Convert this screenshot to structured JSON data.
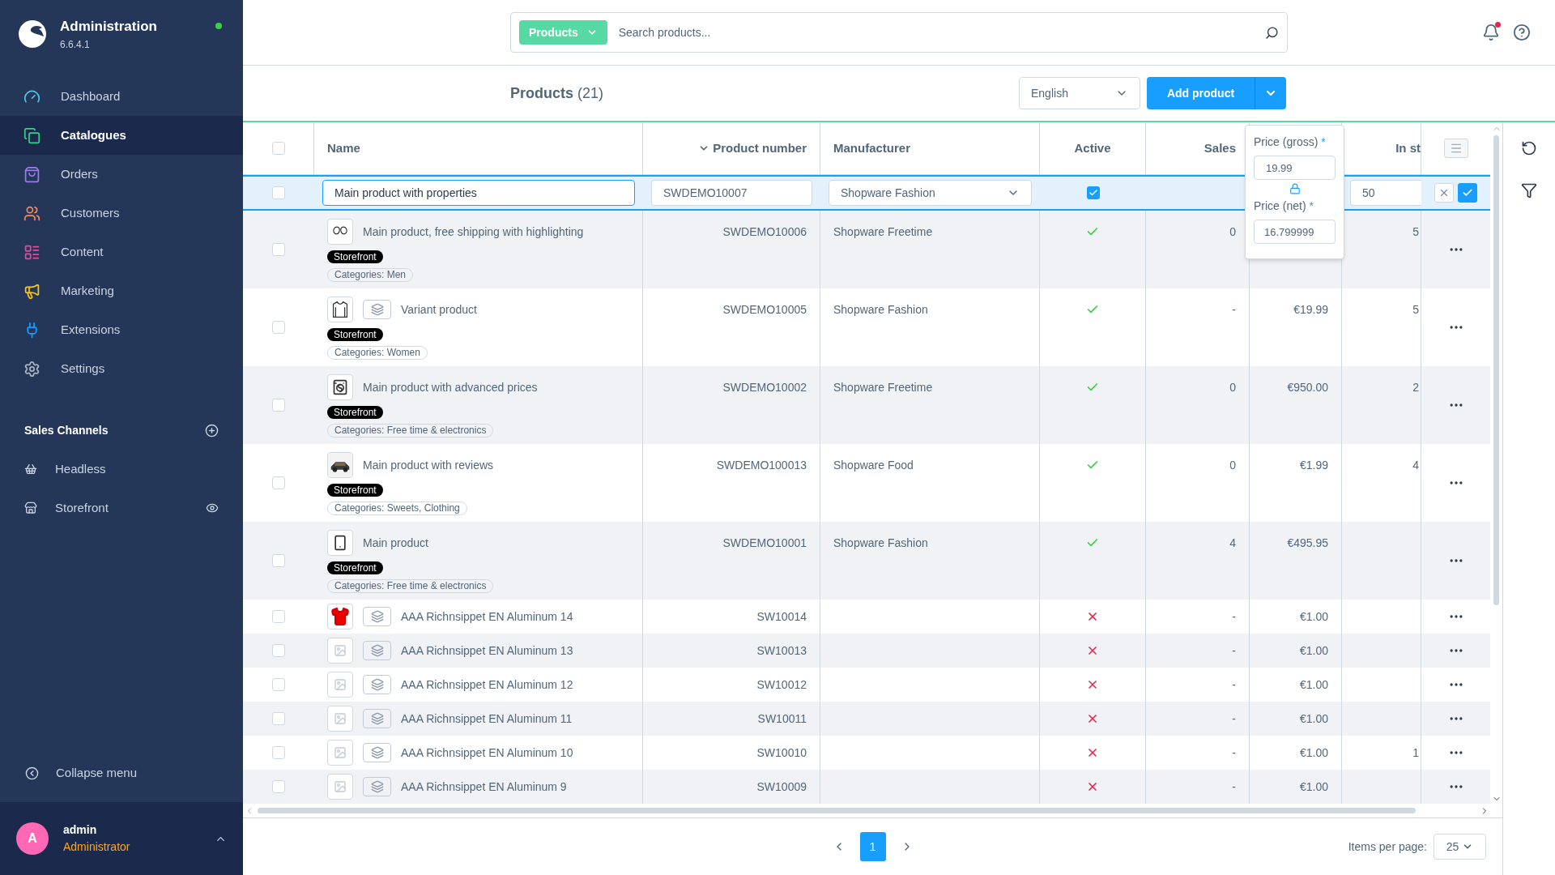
{
  "sidebar": {
    "app_name": "Administration",
    "version": "6.6.4.1",
    "nav": [
      {
        "label": "Dashboard",
        "color": "#52c1e8",
        "selected": false
      },
      {
        "label": "Catalogues",
        "color": "#3cc98c",
        "selected": true
      },
      {
        "label": "Orders",
        "color": "#9a7be8",
        "selected": false
      },
      {
        "label": "Customers",
        "color": "#f08a5d",
        "selected": false
      },
      {
        "label": "Content",
        "color": "#ec4899",
        "selected": false
      },
      {
        "label": "Marketing",
        "color": "#f5c518",
        "selected": false
      },
      {
        "label": "Extensions",
        "color": "#189eff",
        "selected": false
      },
      {
        "label": "Settings",
        "color": "#aab4c3",
        "selected": false
      }
    ],
    "sales_channels": {
      "title": "Sales Channels",
      "items": [
        {
          "label": "Headless"
        },
        {
          "label": "Storefront"
        }
      ]
    },
    "collapse": "Collapse menu",
    "user": {
      "initial": "A",
      "name": "admin",
      "role": "Administrator"
    }
  },
  "search": {
    "scope": "Products",
    "placeholder": "Search products..."
  },
  "header": {
    "title": "Products",
    "count": "(21)",
    "language": "English",
    "add_button": "Add product"
  },
  "table": {
    "all_selected": false,
    "columns": [
      {
        "label": "Name",
        "sorted": false
      },
      {
        "label": "Product number",
        "sorted": true
      },
      {
        "label": "Manufacturer",
        "sorted": false
      },
      {
        "label": "Active",
        "sorted": false
      },
      {
        "label": "Sales",
        "sorted": false
      },
      {
        "label": "In st",
        "sorted": false
      }
    ],
    "edit_row": {
      "selected": false,
      "name": "Main product with properties",
      "product_number": "SWDEMO10007",
      "manufacturer": "Shopware Fashion",
      "active": true,
      "stock": "50"
    },
    "price_popover": {
      "gross_label": "Price (gross)",
      "gross": "19.99",
      "net_label": "Price (net)",
      "net": "16.799999",
      "mark": "*"
    },
    "rows": [
      {
        "selected": false,
        "name": "Main product, free shipping with highlighting",
        "variant": false,
        "badge": "Storefront",
        "categories": "Categories: Men",
        "product_number": "SWDEMO10006",
        "manufacturer": "Shopware Freetime",
        "active": true,
        "sales": "0",
        "stock": "5"
      },
      {
        "selected": false,
        "name": "Variant product",
        "variant": true,
        "badge": "Storefront",
        "categories": "Categories: Women",
        "product_number": "SWDEMO10005",
        "manufacturer": "Shopware Fashion",
        "active": true,
        "sales": "-",
        "price": "€19.99",
        "stock": "5"
      },
      {
        "selected": false,
        "name": "Main product with advanced prices",
        "variant": false,
        "badge": "Storefront",
        "categories": "Categories: Free time & electronics",
        "product_number": "SWDEMO10002",
        "manufacturer": "Shopware Freetime",
        "active": true,
        "sales": "0",
        "price": "€950.00",
        "stock": "2"
      },
      {
        "selected": false,
        "name": "Main product with reviews",
        "variant": false,
        "badge": "Storefront",
        "categories": "Categories: Sweets, Clothing",
        "product_number": "SWDEMO100013",
        "manufacturer": "Shopware Food",
        "active": true,
        "sales": "0",
        "price": "€1.99",
        "stock": "4"
      },
      {
        "selected": false,
        "name": "Main product",
        "variant": false,
        "badge": "Storefront",
        "categories": "Categories: Free time & electronics",
        "product_number": "SWDEMO10001",
        "manufacturer": "Shopware Fashion",
        "active": true,
        "sales": "4",
        "price": "€495.95"
      },
      {
        "selected": false,
        "name": "AAA Richnsippet EN Aluminum 14",
        "variant": true,
        "product_number": "SW10014",
        "active": false,
        "sales": "-",
        "price": "€1.00"
      },
      {
        "selected": false,
        "name": "AAA Richnsippet EN Aluminum 13",
        "variant": true,
        "product_number": "SW10013",
        "active": false,
        "sales": "-",
        "price": "€1.00"
      },
      {
        "selected": false,
        "name": "AAA Richnsippet EN Aluminum 12",
        "variant": true,
        "product_number": "SW10012",
        "active": false,
        "sales": "-",
        "price": "€1.00"
      },
      {
        "selected": false,
        "name": "AAA Richnsippet EN Aluminum 11",
        "variant": true,
        "product_number": "SW10011",
        "active": false,
        "sales": "-",
        "price": "€1.00"
      },
      {
        "selected": false,
        "name": "AAA Richnsippet EN Aluminum 10",
        "variant": true,
        "product_number": "SW10010",
        "active": false,
        "sales": "-",
        "price": "€1.00",
        "stock": "1"
      },
      {
        "selected": false,
        "name": "AAA Richnsippet EN Aluminum 9",
        "variant": true,
        "product_number": "SW10009",
        "active": false,
        "sales": "-",
        "price": "€1.00"
      }
    ]
  },
  "footer": {
    "pages": [
      {
        "label": "1",
        "selected": true
      }
    ],
    "items_per_page_label": "Items per page:",
    "items_per_page": "25"
  }
}
